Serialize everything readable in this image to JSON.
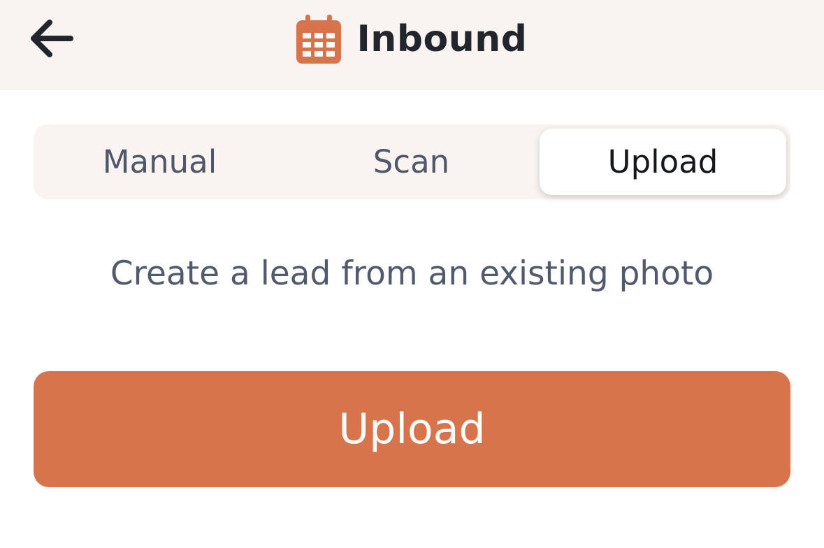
{
  "header": {
    "back_icon": "arrow-left-icon",
    "title_icon": "calendar-icon",
    "title": "Inbound"
  },
  "tabs": [
    {
      "label": "Manual",
      "active": false
    },
    {
      "label": "Scan",
      "active": false
    },
    {
      "label": "Upload",
      "active": true
    }
  ],
  "description": "Create a lead from an existing photo",
  "upload_button": {
    "label": "Upload"
  },
  "colors": {
    "accent": "#d7744c",
    "header_bg": "#f9f4f2",
    "title_text": "#23252d",
    "muted_text": "#4f5769"
  }
}
